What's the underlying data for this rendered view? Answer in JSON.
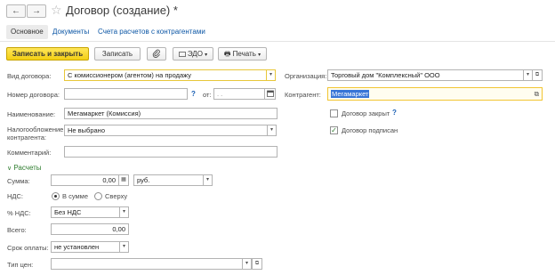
{
  "window": {
    "title": "Договор (создание) *",
    "back_icon": "←",
    "forward_icon": "→",
    "favorite_icon": "☆"
  },
  "tabs": [
    "Основное",
    "Документы",
    "Счета расчетов с контрагентами"
  ],
  "toolbar": {
    "save_close_label": "Записать и закрыть",
    "save_label": "Записать",
    "attach_icon": "📎",
    "edo_label": "ЭДО",
    "print_label": "Печать",
    "print_icon": "🖶"
  },
  "form": {
    "contract_type": {
      "label": "Вид договора:",
      "value": "С комиссионером (агентом) на продажу"
    },
    "contract_number": {
      "label": "Номер договора:",
      "value": "",
      "help": "?"
    },
    "date": {
      "label": "от:",
      "value": ". .",
      "icon": "calendar-icon"
    },
    "name": {
      "label": "Наименование:",
      "value": "Мегамаркет (Комиссия)"
    },
    "taxation": {
      "label": "Налогообложение контрагента:",
      "value": "Не выбрано"
    },
    "comment": {
      "label": "Комментарий:",
      "value": ""
    },
    "organization": {
      "label": "Организация:",
      "value": "Торговый дом \"Комплексный\" ООО"
    },
    "counterparty": {
      "label": "Контрагент:",
      "value": "Мегамаркет"
    },
    "contract_closed": {
      "label": "Договор закрыт",
      "checked": false,
      "help": "?"
    },
    "contract_signed": {
      "label": "Договор подписан",
      "checked": true
    }
  },
  "payments": {
    "section_label": "Расчеты",
    "section_icon": "chevron-down-icon",
    "amount": {
      "label": "Сумма:",
      "value": "0,00",
      "currency": "руб."
    },
    "vat": {
      "label": "НДС:",
      "option_included": "В сумме",
      "option_above": "Сверху",
      "selected": "В сумме"
    },
    "vat_rate": {
      "label": "% НДС:",
      "value": "Без НДС"
    },
    "total": {
      "label": "Всего:",
      "value": "0,00"
    },
    "payment_term": {
      "label": "Срок оплаты:",
      "value": "не установлен"
    },
    "price_type": {
      "label": "Тип цен:",
      "value": ""
    }
  }
}
